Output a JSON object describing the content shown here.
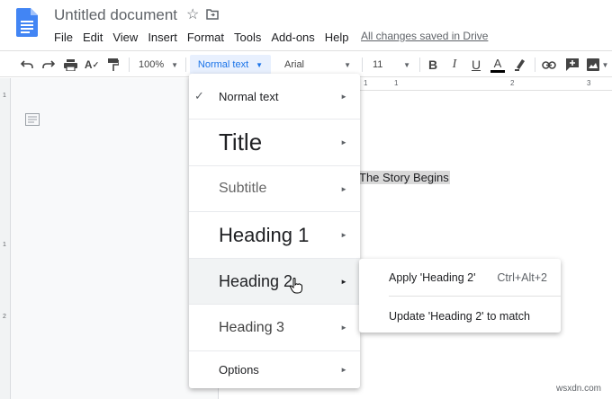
{
  "titlebar": {
    "doc_title": "Untitled document",
    "saved_status": "All changes saved in Drive"
  },
  "menubar": [
    "File",
    "Edit",
    "View",
    "Insert",
    "Format",
    "Tools",
    "Add-ons",
    "Help"
  ],
  "toolbar": {
    "zoom": "100%",
    "paragraph_style": "Normal text",
    "font": "Arial",
    "font_size": "11",
    "icons": [
      "undo-icon",
      "redo-icon",
      "print-icon",
      "spellcheck-icon",
      "paint-format-icon",
      "bold-icon",
      "italic-icon",
      "underline-icon",
      "text-color-icon",
      "highlight-icon",
      "link-icon",
      "comment-icon",
      "image-icon"
    ]
  },
  "ruler": [
    "1",
    "1",
    "2",
    "3"
  ],
  "left_ruler": [
    "1",
    "1",
    "2"
  ],
  "document": {
    "selected_text": "The Story Begins"
  },
  "style_menu": {
    "items": [
      {
        "label": "Normal text",
        "checked": true
      },
      {
        "label": "Title"
      },
      {
        "label": "Subtitle"
      },
      {
        "label": "Heading 1"
      },
      {
        "label": "Heading 2",
        "hovered": true
      },
      {
        "label": "Heading 3"
      },
      {
        "label": "Options"
      }
    ]
  },
  "submenu": {
    "apply_label": "Apply 'Heading 2'",
    "apply_shortcut": "Ctrl+Alt+2",
    "update_label": "Update 'Heading 2' to match"
  },
  "watermark": "wsxdn.com",
  "colors": {
    "accent_blue": "#1a73e8",
    "doc_icon_blue": "#4285f4",
    "selection_gray": "#d9d9d9"
  }
}
